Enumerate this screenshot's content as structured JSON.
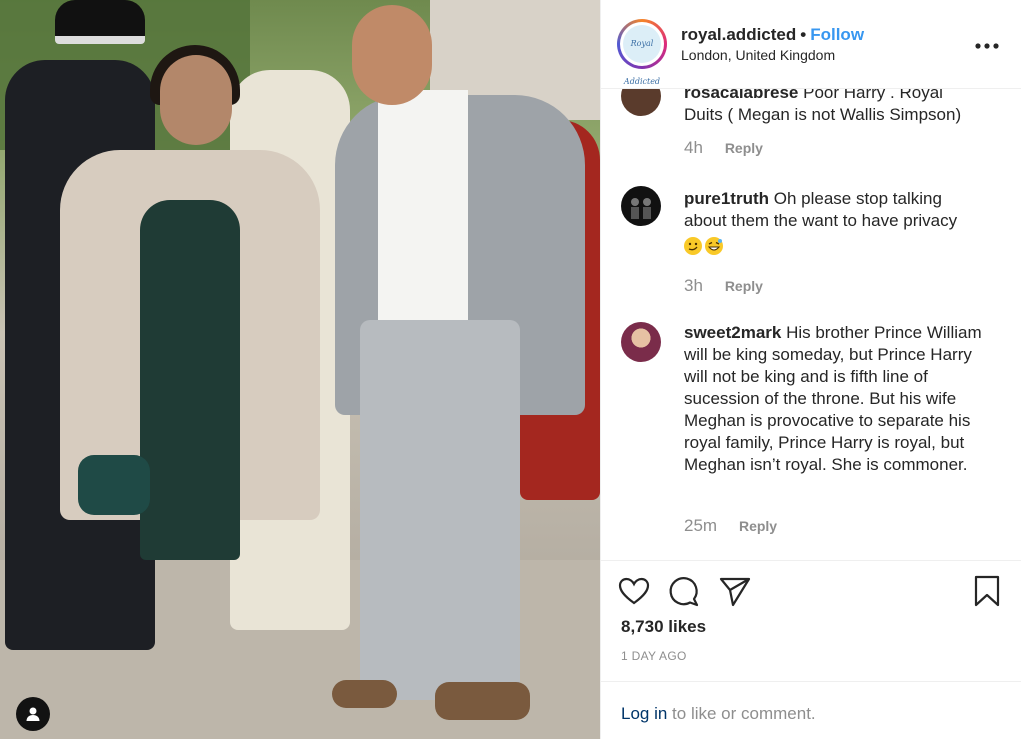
{
  "header": {
    "username": "royal.addicted",
    "separator": "•",
    "follow_label": "Follow",
    "location": "London, United Kingdom",
    "avatar_logo_text": "Royal Addicted",
    "more_icon": "more-horizontal-icon"
  },
  "comments": [
    {
      "username": "rosacalabrese",
      "text": "Poor Harry . Royal Duits ( Megan is not Wallis Simpson)",
      "time": "4h",
      "reply_label": "Reply"
    },
    {
      "username": "pure1truth",
      "text": "Oh please stop talking about them the want to have privacy",
      "emojis": [
        "smirk-emoji",
        "grin-sweat-emoji"
      ],
      "time": "3h",
      "reply_label": "Reply"
    },
    {
      "username": "sweet2mark",
      "text": "His brother Prince William will be king someday, but Prince Harry will not be king and is fifth line of sucession of the throne. But his wife Meghan is provocative to separate his royal family, Prince Harry is royal, but Meghan isn’t royal. She is commoner.",
      "time": "25m",
      "reply_label": "Reply"
    }
  ],
  "actions": {
    "icons": [
      "heart-icon",
      "comment-icon",
      "share-icon",
      "bookmark-icon"
    ],
    "likes": "8,730 likes",
    "posted": "1 DAY AGO"
  },
  "login": {
    "link": "Log in",
    "text": " to like or comment."
  },
  "photo": {
    "user_tag_icon": "user-tag-icon"
  },
  "colors": {
    "link_blue": "#3897f0",
    "login_link": "#003569",
    "muted_text": "#8e8e8e",
    "text": "#262626"
  }
}
